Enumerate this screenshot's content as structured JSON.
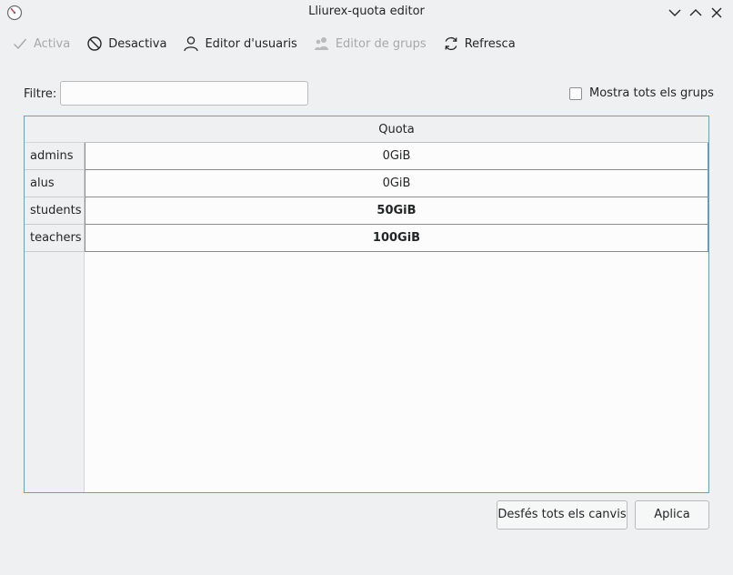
{
  "window": {
    "title": "Lliurex-quota editor"
  },
  "toolbar": {
    "activate_label": "Activa",
    "deactivate_label": "Desactiva",
    "user_editor_label": "Editor d'usuaris",
    "group_editor_label": "Editor de grups",
    "refresh_label": "Refresca"
  },
  "filter": {
    "label": "Filtre:",
    "value": ""
  },
  "show_all": {
    "label": "Mostra tots els grups",
    "checked": false
  },
  "table": {
    "column_header": "Quota",
    "rows": [
      {
        "group": "admins",
        "quota": "0GiB"
      },
      {
        "group": "alus",
        "quota": "0GiB"
      },
      {
        "group": "students",
        "quota": "50GiB"
      },
      {
        "group": "teachers",
        "quota": "100GiB"
      }
    ]
  },
  "actions": {
    "undo_all_label": "Desfés tots els canvis",
    "apply_label": "Aplica"
  }
}
